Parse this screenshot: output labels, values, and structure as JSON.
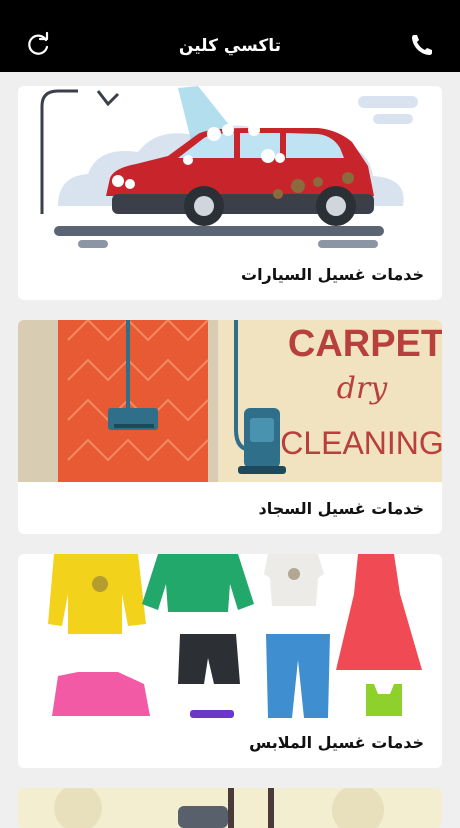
{
  "header": {
    "title": "تاكسي كلين",
    "refresh_icon": "refresh-icon",
    "phone_icon": "phone-icon"
  },
  "services": [
    {
      "label": "خدمات غسيل السيارات",
      "image": "car-wash-illustration"
    },
    {
      "label": "خدمات غسيل السجاد",
      "image": "carpet-cleaning-illustration"
    },
    {
      "label": "خدمات غسيل الملابس",
      "image": "clothes-washing-illustration"
    },
    {
      "label": "",
      "image": "partial-card-illustration"
    }
  ],
  "carpet_art_text": {
    "line1": "CARPET",
    "line2": "dry",
    "line3": "CLEANING"
  },
  "colors": {
    "topbar": "#000000",
    "background": "#efefef",
    "car": "#c8242b",
    "carpet": "#e85a34",
    "carpet_panel": "#f1e2c0"
  }
}
